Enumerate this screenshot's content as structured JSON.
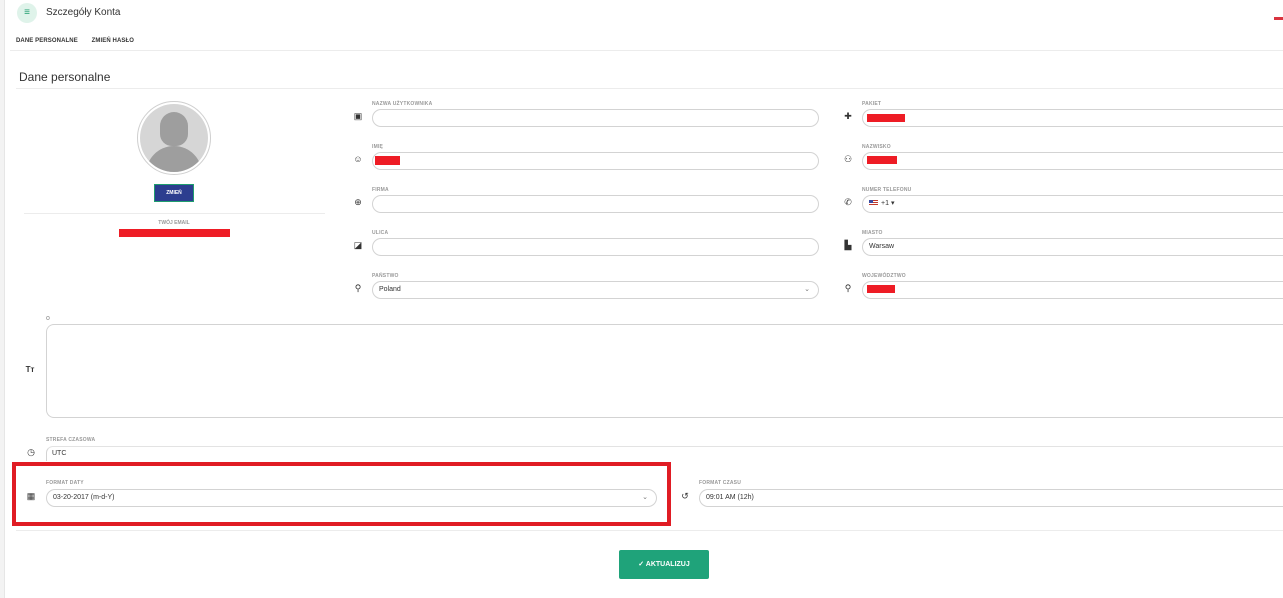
{
  "header": {
    "menu_icon": "hamburger-icon",
    "title": "Szczegóły Konta",
    "language_flag": "flag-pl-icon"
  },
  "tabs": [
    {
      "label": "DANE PERSONALNE"
    },
    {
      "label": "ZMIEŃ HASŁO"
    }
  ],
  "section_title": "Dane personalne",
  "profile": {
    "change_button": "ZMIEŃ",
    "email_label": "TWÓJ EMAIL"
  },
  "fields": {
    "username": {
      "label": "NAZWA UŻYTKOWNIKA",
      "value": "",
      "icon": "id-card-icon"
    },
    "package": {
      "label": "PAKIET",
      "icon": "puzzle-icon"
    },
    "first_name": {
      "label": "IMIĘ",
      "icon": "face-icon"
    },
    "last_name": {
      "label": "NAZWISKO",
      "icon": "user-tag-icon"
    },
    "company": {
      "label": "FIRMA",
      "value": "",
      "icon": "globe-icon"
    },
    "phone": {
      "label": "NUMER TELEFONU",
      "dial_code": "+1",
      "icon": "phone-icon"
    },
    "street": {
      "label": "ULICA",
      "value": "",
      "icon": "map-icon"
    },
    "city": {
      "label": "MIASTO",
      "value": "Warsaw",
      "icon": "city-icon"
    },
    "country": {
      "label": "PAŃSTWO",
      "value": "Poland",
      "icon": "location-pin-icon"
    },
    "province": {
      "label": "WOJEWÓDZTWO",
      "icon": "pin-outline-icon"
    },
    "about": {
      "label": "O",
      "value": "",
      "icon": "text-size-icon"
    },
    "timezone": {
      "label": "STREFA CZASOWA",
      "value": "UTC",
      "icon": "clock-icon"
    },
    "date_format": {
      "label": "FORMAT DATY",
      "value": "03-20-2017 (m-d-Y)",
      "icon": "calendar-icon"
    },
    "time_format": {
      "label": "FORMAT CZASU",
      "value": "09:01 AM (12h)",
      "icon": "history-icon"
    }
  },
  "submit_button": "AKTUALIZUJ",
  "colors": {
    "accent": "#1fa37a",
    "change_button": "#2c3e8f",
    "highlight": "#e01c24",
    "redaction": "#ee1c25"
  }
}
